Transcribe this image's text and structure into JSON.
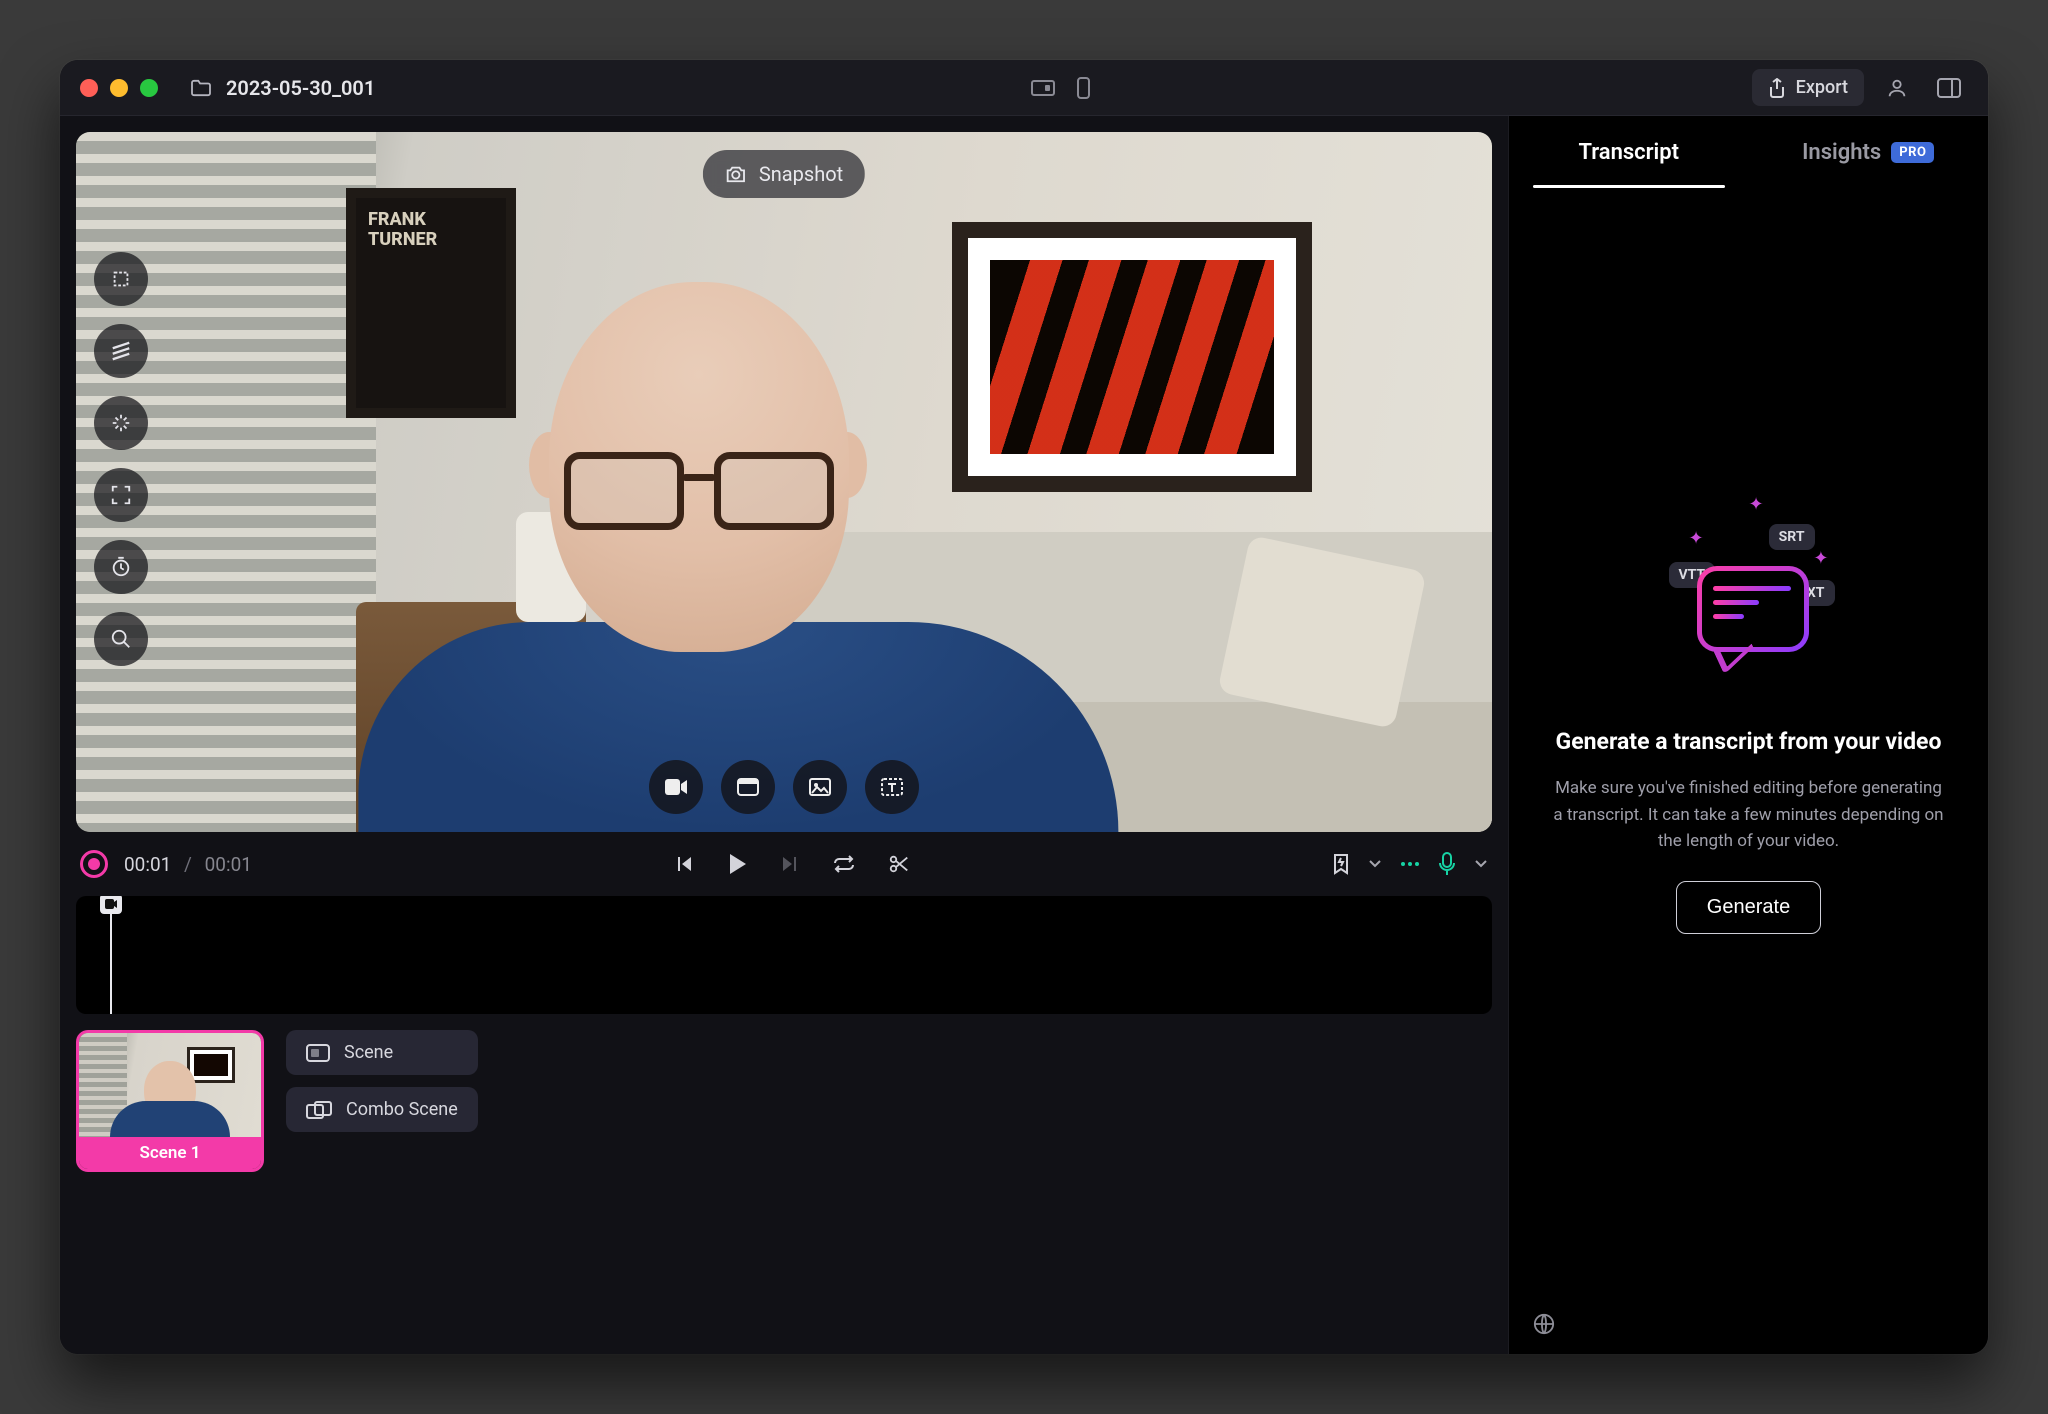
{
  "titlebar": {
    "project_title": "2023-05-30_001",
    "export_label": "Export"
  },
  "preview": {
    "snapshot_label": "Snapshot",
    "poster_left_text": "FRANK TURNER",
    "vtools": [
      "crop",
      "effects",
      "magic",
      "center",
      "timer",
      "search"
    ],
    "media_buttons": [
      "camera",
      "window",
      "image",
      "text-overlay"
    ]
  },
  "transport": {
    "current_time": "00:01",
    "duration": "00:01",
    "buttons": [
      "prev",
      "play",
      "next",
      "loop",
      "cut"
    ]
  },
  "scenes": {
    "thumb_label": "Scene 1",
    "scene_btn": "Scene",
    "combo_btn": "Combo Scene"
  },
  "side": {
    "tab_transcript": "Transcript",
    "tab_insights": "Insights",
    "pro_badge": "PRO",
    "chips": {
      "srt": "SRT",
      "vtt": "VTT",
      "txt": "TXT"
    },
    "title": "Generate a transcript from your video",
    "desc": "Make sure you've finished editing before generating a transcript. It can take a few minutes depending on the length of your video.",
    "generate_btn": "Generate"
  }
}
